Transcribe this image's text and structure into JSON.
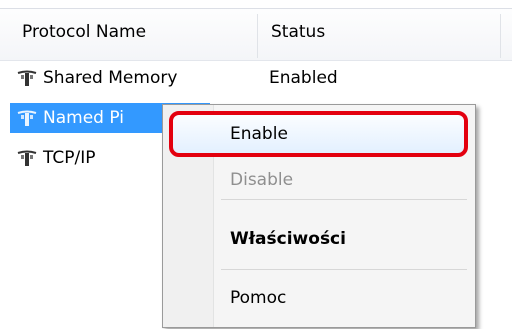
{
  "columns": {
    "name": "Protocol Name",
    "status": "Status"
  },
  "rows": [
    {
      "name": "Shared Memory",
      "status": "Enabled",
      "icon": "protocol-icon"
    },
    {
      "name": "Named Pi",
      "status": "",
      "icon": "protocol-icon"
    },
    {
      "name": "TCP/IP",
      "status": "",
      "icon": "protocol-icon"
    }
  ],
  "context_menu": {
    "enable": "Enable",
    "disable": "Disable",
    "properties": "Właściwości",
    "help": "Pomoc"
  },
  "colors": {
    "selection": "#3399ff",
    "highlight_border": "#e3000f"
  }
}
